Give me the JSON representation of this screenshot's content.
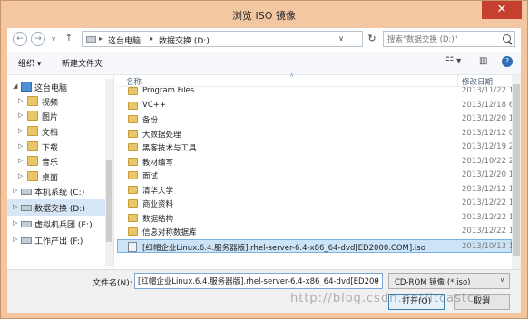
{
  "window": {
    "title": "浏览 ISO 镜像",
    "close_glyph": "✕"
  },
  "nav": {
    "back_glyph": "←",
    "forward_glyph": "→",
    "history_glyph": "∨",
    "up_glyph": "↑",
    "breadcrumbs": [
      "这台电脑",
      "数据交换 (D:)"
    ],
    "crumb_sep": "▸",
    "dropdown_glyph": "∨",
    "refresh_glyph": "↻",
    "search_placeholder": "搜索\"数据交换 (D:)\""
  },
  "toolbar": {
    "organize_label": "组织 ▾",
    "new_folder_label": "新建文件夹",
    "view_glyph": "☷ ▾",
    "pane_glyph": "▥",
    "help_glyph": "?"
  },
  "sidebar": {
    "items": [
      {
        "label": "这台电脑",
        "icon": "computer-icon",
        "arrow": "◢"
      },
      {
        "label": "视频",
        "icon": "folder-icon",
        "arrow": "▷"
      },
      {
        "label": "图片",
        "icon": "folder-icon",
        "arrow": "▷"
      },
      {
        "label": "文档",
        "icon": "folder-icon",
        "arrow": "▷"
      },
      {
        "label": "下载",
        "icon": "folder-icon",
        "arrow": "▷"
      },
      {
        "label": "音乐",
        "icon": "folder-icon",
        "arrow": "▷"
      },
      {
        "label": "桌面",
        "icon": "folder-icon",
        "arrow": "▷"
      },
      {
        "label": "本机系统 (C:)",
        "icon": "drive-icon",
        "arrow": "▷"
      },
      {
        "label": "数据交换 (D:)",
        "icon": "drive-icon",
        "arrow": "▷"
      },
      {
        "label": "虚拟机兵团 (E:)",
        "icon": "drive-icon",
        "arrow": "▷"
      },
      {
        "label": "工作产出 (F:)",
        "icon": "drive-icon",
        "arrow": "▷"
      }
    ],
    "selected_index": 8
  },
  "filelist": {
    "columns": {
      "name": "名称",
      "date": "修改日期",
      "sort_glyph": "∧"
    },
    "rows": [
      {
        "name": "Program Files",
        "date": "2013/11/22 1",
        "type": "folder"
      },
      {
        "name": "VC++",
        "date": "2013/12/18 6",
        "type": "folder"
      },
      {
        "name": "备份",
        "date": "2013/12/20 1",
        "type": "folder"
      },
      {
        "name": "大数据处理",
        "date": "2013/12/12 0",
        "type": "folder"
      },
      {
        "name": "黑客技术与工具",
        "date": "2013/12/19 2",
        "type": "folder"
      },
      {
        "name": "教材编写",
        "date": "2013/10/22 2",
        "type": "folder"
      },
      {
        "name": "面试",
        "date": "2013/12/20 1",
        "type": "folder"
      },
      {
        "name": "清华大学",
        "date": "2013/12/12 1",
        "type": "folder"
      },
      {
        "name": "商业资料",
        "date": "2013/12/22 1",
        "type": "folder"
      },
      {
        "name": "数据结构",
        "date": "2013/12/22 1",
        "type": "folder"
      },
      {
        "name": "信息对称数据库",
        "date": "2013/12/22 1",
        "type": "folder"
      },
      {
        "name": "[红帽企业Linux.6.4.服务器版].rhel-server-6.4-x86_64-dvd[ED2000.COM].iso",
        "date": "2013/10/13 1",
        "type": "iso"
      }
    ],
    "selected_index": 11
  },
  "footer": {
    "filename_label": "文件名(N):",
    "filename_value": "[红帽企业Linux.6.4.服务器版].rhel-server-6.4-x86_64-dvd[ED200",
    "dropdown_glyph": "∨",
    "filetype_value": "CD-ROM 镜像 (*.iso)",
    "open_label": "打开(O)",
    "cancel_label": "取消"
  },
  "watermark": "http://blog.csdn.net/itcastcpp"
}
